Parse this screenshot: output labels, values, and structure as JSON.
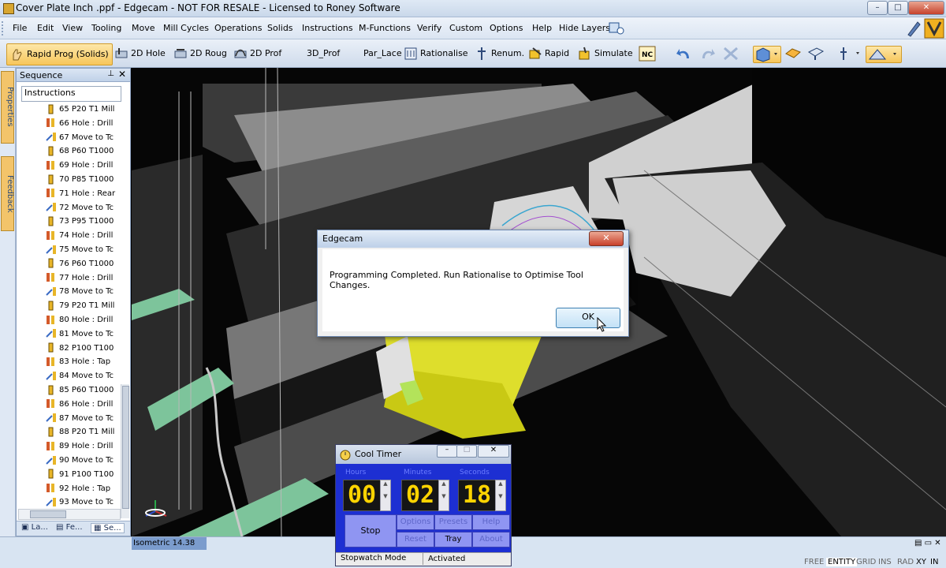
{
  "window": {
    "title": "Cover Plate Inch .ppf - Edgecam - NOT FOR RESALE - Licensed to Roney Software",
    "controls": {
      "minimize": "–",
      "maximize": "□",
      "close": "✕"
    }
  },
  "menu": {
    "items": [
      "File",
      "Edit",
      "View",
      "Tooling",
      "Move",
      "Mill Cycles",
      "Operations",
      "Solids",
      "Instructions",
      "M-Functions",
      "Verify",
      "Custom",
      "Options",
      "Help",
      "Hide Layers"
    ]
  },
  "toolbar": {
    "buttons": [
      "Rapid Prog (Solids)",
      "2D Hole",
      "2D Roug",
      "2D Prof",
      "3D_Prof",
      "Par_Lace",
      "Rationalise",
      "Renum.",
      "Rapid",
      "Simulate"
    ]
  },
  "side_tabs": {
    "properties": "Properties",
    "feedback": "Feedback"
  },
  "sequence": {
    "header": "Sequence",
    "root": "Instructions",
    "items": [
      "65 P20 T1 Mill",
      "66 Hole : Drill",
      "67 Move to Tc",
      "68 P60 T1000",
      "69 Hole : Drill",
      "70 P85 T1000",
      "71 Hole : Rear",
      "72 Move to Tc",
      "73 P95 T1000",
      "74 Hole : Drill",
      "75 Move to Tc",
      "76 P60 T1000",
      "77 Hole : Drill",
      "78 Move to Tc",
      "79 P20 T1 Mill",
      "80 Hole : Drill",
      "81 Move to Tc",
      "82 P100 T100",
      "83 Hole : Tap",
      "84 Move to Tc",
      "85 P60 T1000",
      "86 Hole : Drill",
      "87 Move to Tc",
      "88 P20 T1 Mill",
      "89 Hole : Drill",
      "90 Move to Tc",
      "91 P100 T100",
      "92 Hole : Tap",
      "93 Move to Tc"
    ],
    "bottom_tabs": [
      "La...",
      "Fe...",
      "Se..."
    ]
  },
  "viewport": {
    "view_label": "Isometric 14.38"
  },
  "dialog": {
    "title": "Edgecam",
    "message": "Programming Completed. Run Rationalise to Optimise Tool Changes.",
    "ok_label": "OK",
    "close_label": "✕"
  },
  "timer": {
    "title": "Cool Timer",
    "hours": "00",
    "minutes": "02",
    "seconds": "18",
    "labels": {
      "hours": "Hours",
      "minutes": "Minutes",
      "seconds": "Seconds"
    },
    "stop_label": "Stop",
    "buttons": [
      "Options",
      "Presets",
      "Help",
      "Reset",
      "Tray",
      "About"
    ],
    "status_mode": "Stopwatch Mode",
    "status_state": "Activated"
  },
  "statusbar": {
    "items": [
      "FREE",
      "ENTITY",
      "GRID",
      "INS",
      "RAD",
      "XY",
      "IN"
    ]
  }
}
